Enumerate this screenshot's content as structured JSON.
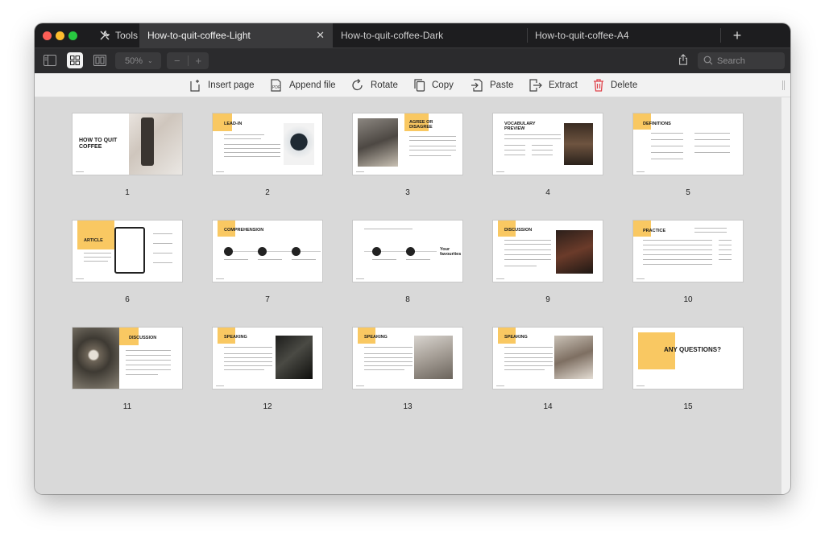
{
  "app": {
    "tools_label": "Tools",
    "tabs": [
      {
        "label": "How-to-quit-coffee-Light",
        "active": true
      },
      {
        "label": "How-to-quit-coffee-Dark",
        "active": false
      },
      {
        "label": "How-to-quit-coffee-A4",
        "active": false
      }
    ],
    "new_tab_icon": "plus-icon"
  },
  "toolbar": {
    "zoom_value": "50%",
    "stepper_minus": "−",
    "stepper_plus": "+",
    "search_placeholder": "Search"
  },
  "actions": [
    {
      "label": "Insert page",
      "icon": "insert-page-icon"
    },
    {
      "label": "Append file",
      "icon": "append-file-icon"
    },
    {
      "label": "Rotate",
      "icon": "rotate-icon"
    },
    {
      "label": "Copy",
      "icon": "copy-icon"
    },
    {
      "label": "Paste",
      "icon": "paste-icon"
    },
    {
      "label": "Extract",
      "icon": "extract-icon"
    },
    {
      "label": "Delete",
      "icon": "delete-icon"
    }
  ],
  "pages": [
    {
      "number": "1",
      "title": "HOW TO QUIT COFFEE"
    },
    {
      "number": "2",
      "title": "LEAD-IN"
    },
    {
      "number": "3",
      "title": "AGREE OR DISAGREE"
    },
    {
      "number": "4",
      "title": "VOCABULARY PREVIEW"
    },
    {
      "number": "5",
      "title": "DEFINITIONS"
    },
    {
      "number": "6",
      "title": "ARTICLE"
    },
    {
      "number": "7",
      "title": "COMPREHENSION"
    },
    {
      "number": "8",
      "title": "Your favourites"
    },
    {
      "number": "9",
      "title": "DISCUSSION"
    },
    {
      "number": "10",
      "title": "PRACTICE"
    },
    {
      "number": "11",
      "title": "DISCUSSION"
    },
    {
      "number": "12",
      "title": "SPEAKING"
    },
    {
      "number": "13",
      "title": "SPEAKING"
    },
    {
      "number": "14",
      "title": "SPEAKING"
    },
    {
      "number": "15",
      "title": "ANY QUESTIONS?"
    }
  ],
  "colors": {
    "accent_yellow": "#f9c862",
    "delete_red": "#e0424a",
    "titlebar": "#1d1d1f"
  }
}
